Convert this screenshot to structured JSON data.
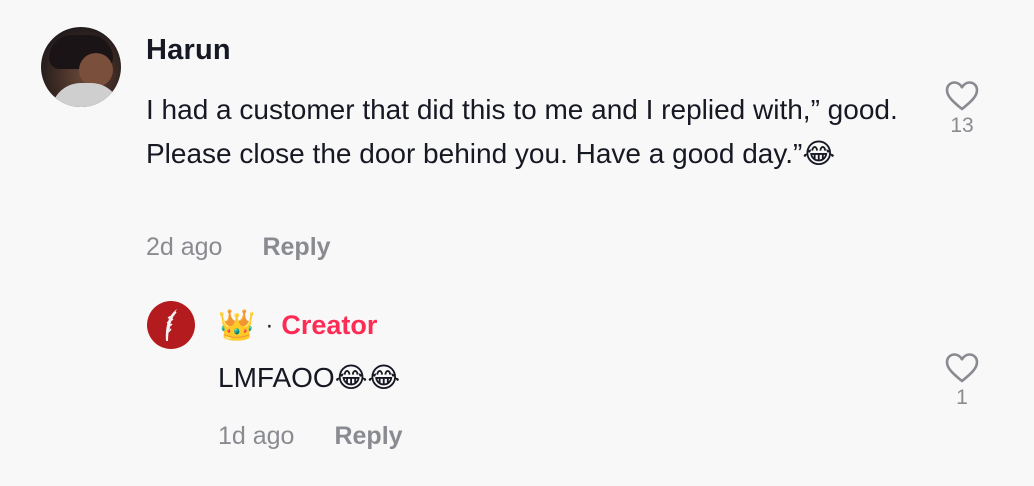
{
  "comment": {
    "username": "Harun",
    "text": "I had a customer that did this to me and I replied with,” good. Please close the door behind you. Have a good day.”",
    "emoji": "😂",
    "time": "2d ago",
    "reply_label": "Reply",
    "likes": "13"
  },
  "reply": {
    "crown": "👑",
    "separator": "·",
    "badge": "Creator",
    "text": "LMFAOO",
    "emojis": "😂😂",
    "time": "1d ago",
    "reply_label": "Reply",
    "likes": "1"
  },
  "colors": {
    "background": "#f8f8f8",
    "text": "#161823",
    "muted": "#8a8b91",
    "creator": "#fe2c55",
    "reply_avatar": "#b31b1e"
  },
  "icons": {
    "like": "heart-outline-icon",
    "reply_avatar_symbol": "feather-icon"
  }
}
